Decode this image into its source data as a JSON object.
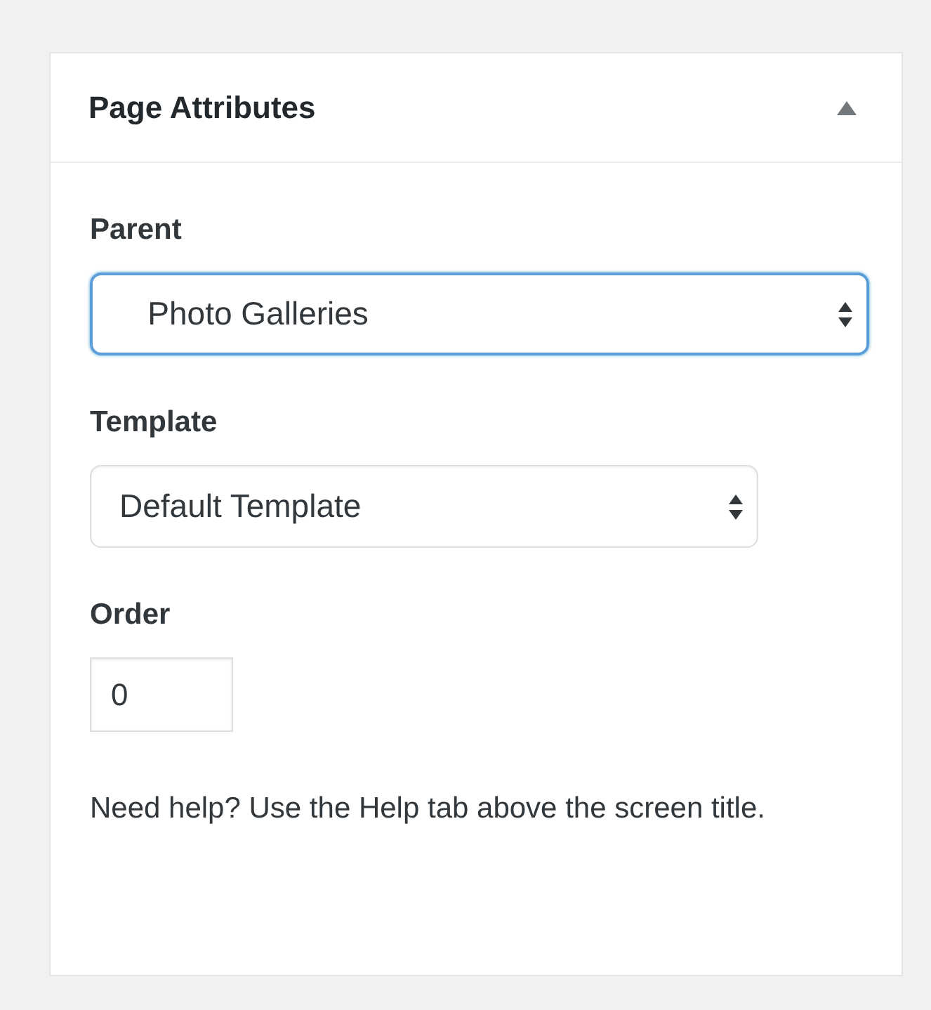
{
  "panel": {
    "title": "Page Attributes",
    "expanded": true
  },
  "fields": [
    {
      "kind": "select",
      "label": "Parent",
      "value": "   Photo Galleries",
      "focused": true
    },
    {
      "kind": "select",
      "label": "Template",
      "value": "Default Template",
      "focused": false
    },
    {
      "kind": "number",
      "label": "Order",
      "value": "0",
      "focused": false
    }
  ],
  "help": "Need help? Use the Help tab above the screen title."
}
